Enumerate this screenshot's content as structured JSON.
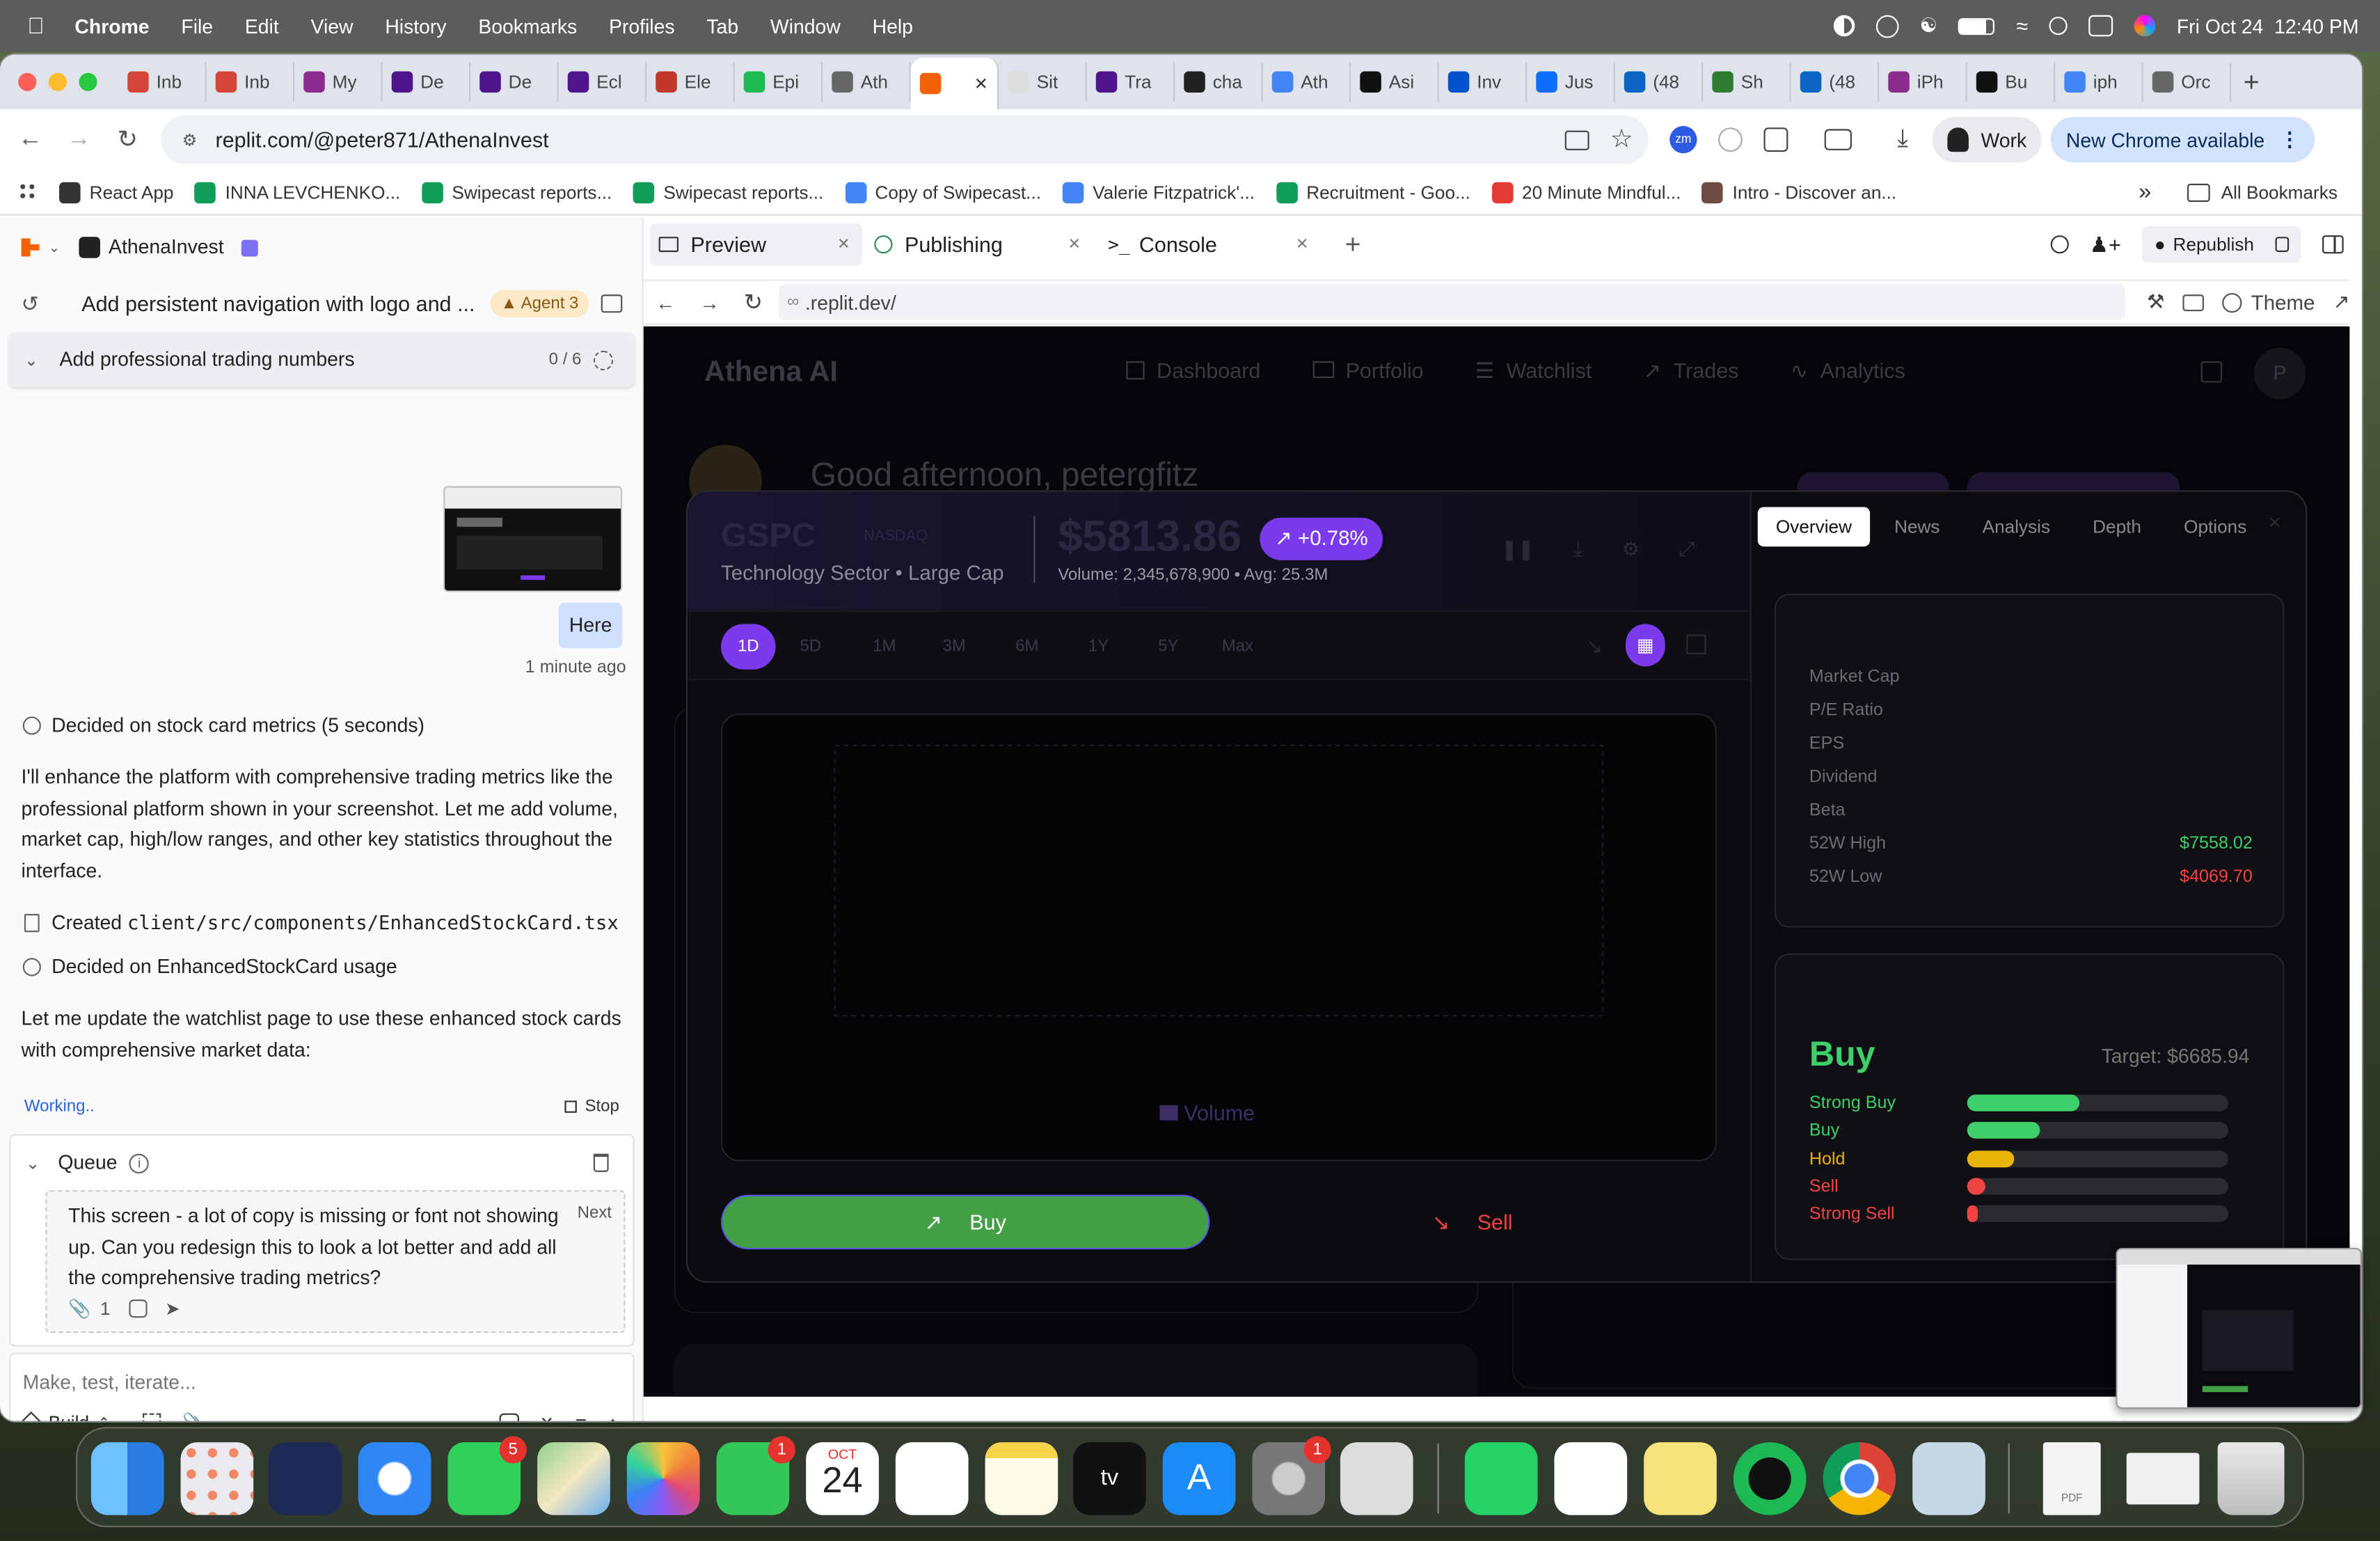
{
  "menubar": {
    "app": "Chrome",
    "items": [
      "File",
      "Edit",
      "View",
      "History",
      "Bookmarks",
      "Profiles",
      "Tab",
      "Window",
      "Help"
    ],
    "datetime": "Fri Oct 24  12:40 PM"
  },
  "tabs": [
    {
      "label": "Inb",
      "color": "#d44638"
    },
    {
      "label": "Inb",
      "color": "#d44638"
    },
    {
      "label": "My",
      "color": "#8b2c8e"
    },
    {
      "label": "De",
      "color": "#4d148c"
    },
    {
      "label": "De",
      "color": "#4d148c"
    },
    {
      "label": "Ecl",
      "color": "#4d148c"
    },
    {
      "label": "Ele",
      "color": "#c0392b"
    },
    {
      "label": "Epi",
      "color": "#1db954"
    },
    {
      "label": "Ath",
      "color": "#666"
    },
    {
      "label": "",
      "color": "#f26207",
      "active": true
    },
    {
      "label": "Sit",
      "color": "#ddd"
    },
    {
      "label": "Tra",
      "color": "#4d148c"
    },
    {
      "label": "cha",
      "color": "#222"
    },
    {
      "label": "Ath",
      "color": "#4285f4"
    },
    {
      "label": "Asi",
      "color": "#111"
    },
    {
      "label": "Inv",
      "color": "#0052cc"
    },
    {
      "label": "Jus",
      "color": "#0d6efd"
    },
    {
      "label": "(48",
      "color": "#0a66c2"
    },
    {
      "label": "Sh",
      "color": "#2e7d32"
    },
    {
      "label": "(48",
      "color": "#0a66c2"
    },
    {
      "label": "iPh",
      "color": "#8b2c8e"
    },
    {
      "label": "Bu",
      "color": "#111"
    },
    {
      "label": "iph",
      "color": "#4285f4"
    },
    {
      "label": "Orc",
      "color": "#666"
    }
  ],
  "address": {
    "url": "replit.com/@peter871/AthenaInvest",
    "profile": "Work",
    "update": "New Chrome available",
    "zm": "zm"
  },
  "bookmarks": [
    {
      "label": "React App",
      "color": "#333"
    },
    {
      "label": "INNA LEVCHENKO...",
      "color": "#0f9d58"
    },
    {
      "label": "Swipecast reports...",
      "color": "#0f9d58"
    },
    {
      "label": "Swipecast reports...",
      "color": "#0f9d58"
    },
    {
      "label": "Copy of Swipecast...",
      "color": "#4285f4"
    },
    {
      "label": "Valerie Fitzpatrick'...",
      "color": "#4285f4"
    },
    {
      "label": "Recruitment - Goo...",
      "color": "#0f9d58"
    },
    {
      "label": "20 Minute Mindful...",
      "color": "#e53935"
    },
    {
      "label": "Intro - Discover an...",
      "color": "#6d4c41"
    }
  ],
  "all_bookmarks": "All Bookmarks",
  "replit": {
    "project": "AthenaInvest",
    "thread_title": "Add persistent navigation with logo and ...",
    "agent_badge": "Agent 3",
    "task_title": "Add professional trading numbers",
    "task_count": "0 / 6",
    "bubble": "Here",
    "time": "1 minute ago",
    "decided1": "Decided on stock card metrics (5 seconds)",
    "para1": "I'll enhance the platform with comprehensive trading metrics like the professional platform shown in your screenshot. Let me add volume, market cap, high/low ranges, and other key statistics throughout the interface.",
    "created_prefix": "Created ",
    "created_file": "client/src/components/EnhancedStockCard.tsx",
    "decided2": "Decided on EnhancedStockCard usage",
    "para2": "Let me update the watchlist page to use these enhanced stock cards with comprehensive market data:",
    "working": "Working..",
    "stop": "Stop",
    "queue": "Queue",
    "queued_msg": "This screen - a lot of copy is missing or font not showing up. Can you redesign this to look a lot better and add all the comprehensive trading metrics?",
    "next": "Next",
    "attach_count": "1",
    "input_placeholder": "Make, test, iterate...",
    "build": "Build"
  },
  "workspace": {
    "tabs": [
      "Preview",
      "Publishing",
      "Console"
    ],
    "republish": "Republish",
    "preview_url": ".replit.dev/",
    "theme": "Theme"
  },
  "app": {
    "brand": "Athena AI",
    "nav": [
      "Dashboard",
      "Portfolio",
      "Watchlist",
      "Trades",
      "Analytics"
    ],
    "avatar": "P",
    "greeting": "Good afternoon, petergfitz"
  },
  "stock": {
    "ticker": "GSPC",
    "exchange": "NASDAQ",
    "sector": "Technology Sector • Large Cap",
    "price": "$5813.86",
    "change": "+0.78%",
    "volume_line": "Volume: 2,345,678,900 • Avg: 25.3M",
    "timeframes": [
      "1D",
      "5D",
      "1M",
      "3M",
      "6M",
      "1Y",
      "5Y",
      "Max"
    ],
    "active_timeframe": "1D",
    "legend_volume": "Volume",
    "buy": "Buy",
    "sell": "Sell",
    "side_tabs": [
      "Overview",
      "News",
      "Analysis",
      "Depth",
      "Options"
    ],
    "metrics": [
      {
        "label": "Market Cap",
        "value": ""
      },
      {
        "label": "P/E Ratio",
        "value": ""
      },
      {
        "label": "EPS",
        "value": ""
      },
      {
        "label": "Dividend",
        "value": ""
      },
      {
        "label": "Beta",
        "value": ""
      },
      {
        "label": "52W High",
        "value": "$7558.02",
        "color": "#3ecf6a"
      },
      {
        "label": "52W Low",
        "value": "$4069.70",
        "color": "#ef4444"
      }
    ],
    "rating": "Buy",
    "target": "Target: $6685.94",
    "analyst": [
      {
        "label": "Strong Buy",
        "pct": 0.43,
        "color": "#3ecf6a"
      },
      {
        "label": "Buy",
        "pct": 0.28,
        "color": "#3ecf6a"
      },
      {
        "label": "Hold",
        "pct": 0.18,
        "color": "#eab308"
      },
      {
        "label": "Sell",
        "pct": 0.07,
        "color": "#ef4444"
      },
      {
        "label": "Strong Sell",
        "pct": 0.04,
        "color": "#ef4444"
      }
    ]
  },
  "dock": {
    "calendar_month": "OCT",
    "calendar_day": "24",
    "messages_badge": "5",
    "facetime_badge": "1",
    "settings_badge": "1",
    "pdf": "PDF"
  }
}
